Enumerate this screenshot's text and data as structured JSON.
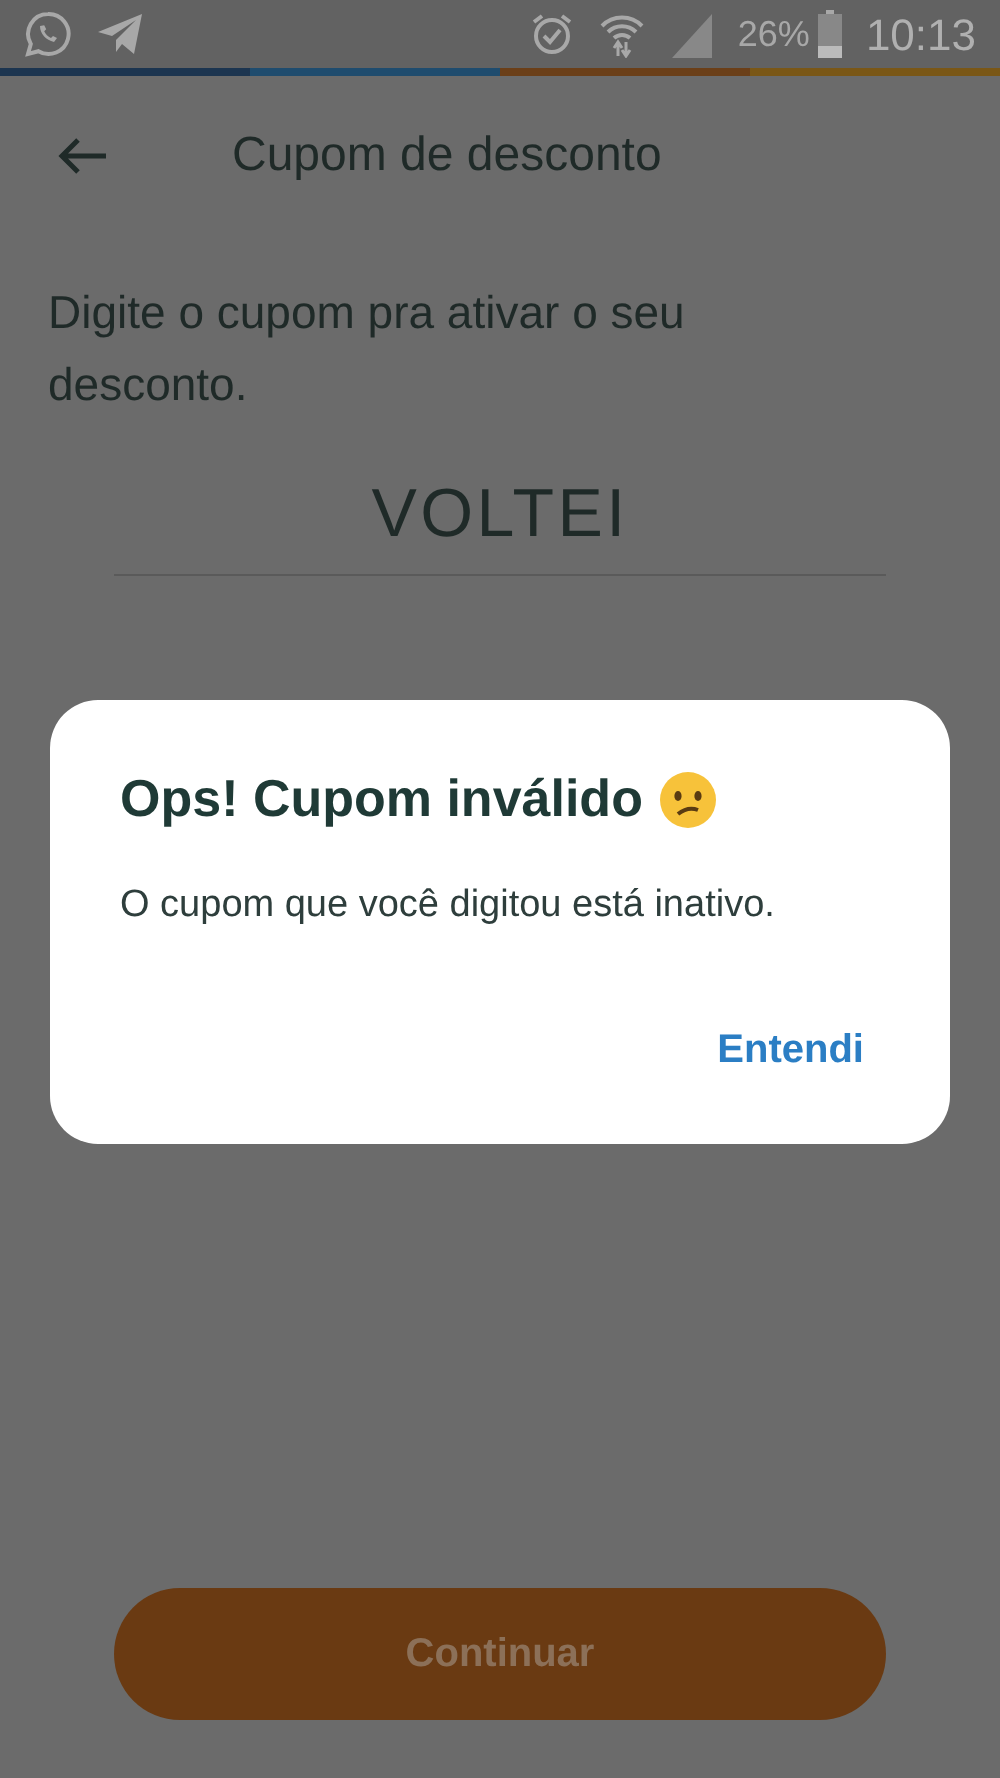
{
  "status_bar": {
    "battery": "26%",
    "time": "10:13"
  },
  "header": {
    "title": "Cupom de desconto"
  },
  "instruction": "Digite o cupom pra ativar o seu desconto.",
  "coupon_field": {
    "value": "VOLTEI"
  },
  "continue_button": {
    "label": "Continuar",
    "disabled": true
  },
  "dialog": {
    "title": "Ops! Cupom inválido",
    "message": "O cupom que você digitou está inativo.",
    "action": "Entendi"
  }
}
